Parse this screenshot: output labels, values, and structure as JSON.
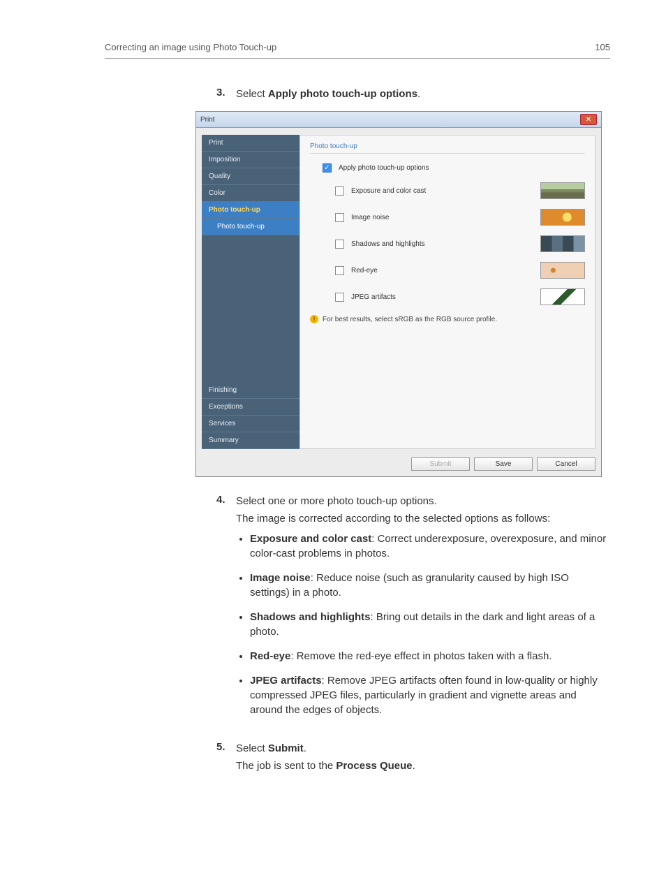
{
  "header": {
    "left": "Correcting an image using Photo Touch-up",
    "right": "105"
  },
  "steps": {
    "s3": {
      "num": "3.",
      "text_a": "Select ",
      "bold": "Apply photo touch-up options",
      "text_b": "."
    },
    "s4": {
      "num": "4.",
      "line1": "Select one or more photo touch-up options.",
      "line2": "The image is corrected according to the selected options as follows:"
    },
    "s5": {
      "num": "5.",
      "line1a": "Select ",
      "line1b": "Submit",
      "line1c": ".",
      "line2a": "The job is sent to the ",
      "line2b": "Process Queue",
      "line2c": "."
    }
  },
  "bullets": [
    {
      "title": "Exposure and color cast",
      "text": ": Correct underexposure, overexposure, and minor color-cast problems in photos."
    },
    {
      "title": "Image noise",
      "text": ": Reduce noise (such as granularity caused by high ISO settings) in a photo."
    },
    {
      "title": "Shadows and highlights",
      "text": ": Bring out details in the dark and light areas of a photo."
    },
    {
      "title": "Red-eye",
      "text": ": Remove the red-eye effect in photos taken with a flash."
    },
    {
      "title": "JPEG artifacts",
      "text": ": Remove JPEG artifacts often found in low-quality or highly compressed JPEG files, particularly in gradient and vignette areas and around the edges of objects."
    }
  ],
  "dialog": {
    "title": "Print",
    "close": "✕",
    "sidebar": {
      "print": "Print",
      "imposition": "Imposition",
      "quality": "Quality",
      "color": "Color",
      "photo_touchup": "Photo touch-up",
      "photo_touchup_sub": "Photo touch-up",
      "finishing": "Finishing",
      "exceptions": "Exceptions",
      "services": "Services",
      "summary": "Summary"
    },
    "pane": {
      "title": "Photo touch-up",
      "apply": "Apply photo touch-up options",
      "exposure": "Exposure and color cast",
      "noise": "Image noise",
      "shadows": "Shadows and highlights",
      "redeye": "Red-eye",
      "jpeg": "JPEG artifacts",
      "note": "For best results, select sRGB as the RGB source profile."
    },
    "buttons": {
      "submit": "Submit",
      "save": "Save",
      "cancel": "Cancel"
    }
  }
}
